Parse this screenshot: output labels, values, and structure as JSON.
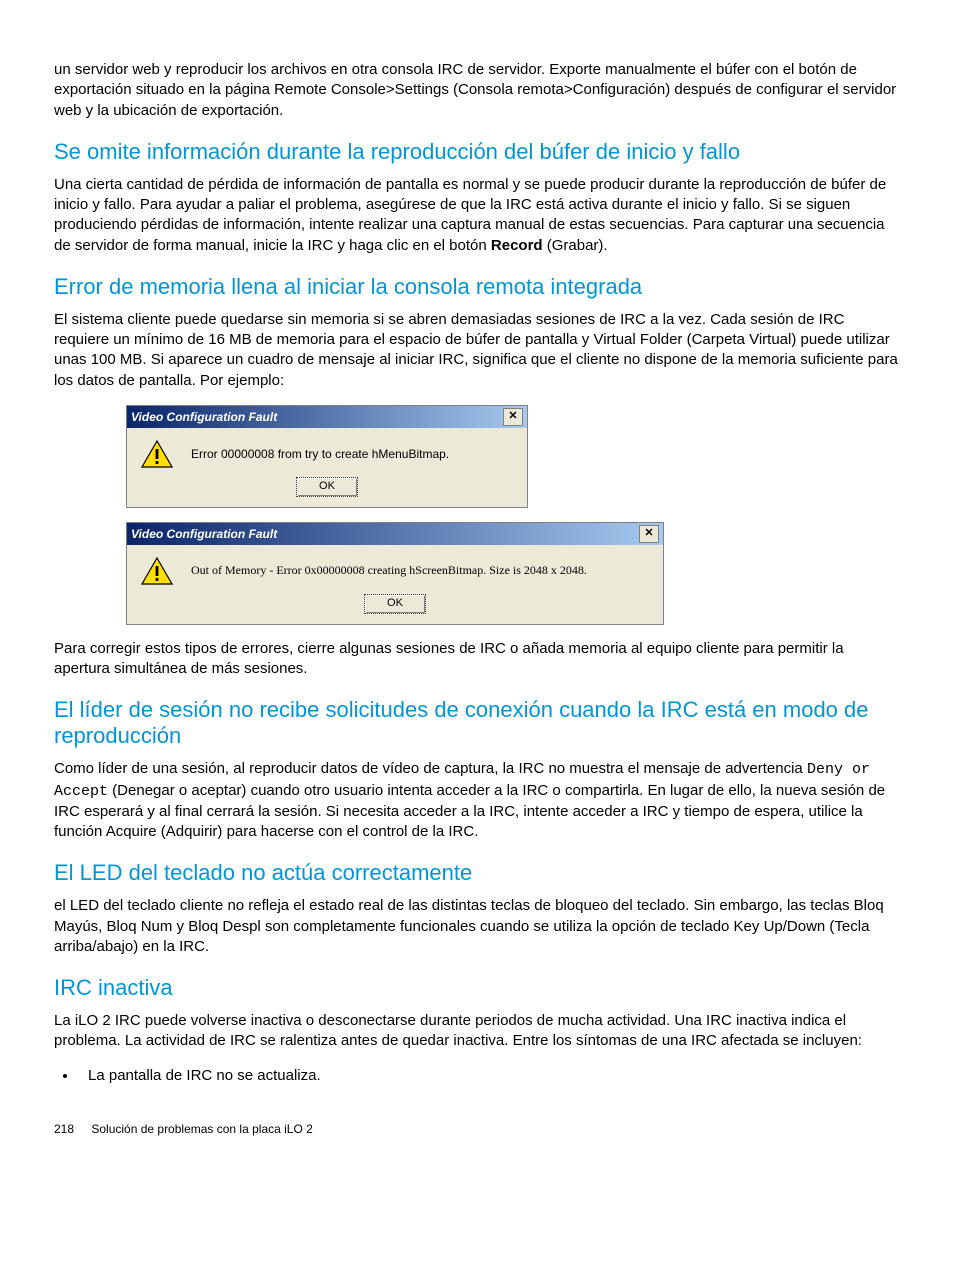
{
  "intro_para": "un servidor web y reproducir los archivos en otra consola IRC de servidor. Exporte manualmente el búfer con el botón de exportación situado en la página Remote Console>Settings (Consola remota>Configuración) después de configurar el servidor web y la ubicación de exportación.",
  "sect1": {
    "title": "Se omite información durante la reproducción del búfer de inicio y fallo",
    "para_pre": "Una cierta cantidad de pérdida de información de pantalla es normal y se puede producir durante la reproducción de búfer de inicio y fallo. Para ayudar a paliar el problema, asegúrese de que la IRC está activa durante el inicio y fallo. Si se siguen produciendo pérdidas de información, intente realizar una captura manual de estas secuencias. Para capturar una secuencia de servidor de forma manual, inicie la IRC y haga clic en el botón ",
    "record_bold": "Record",
    "para_post": " (Grabar)."
  },
  "sect2": {
    "title": "Error de memoria llena al iniciar la consola remota integrada",
    "para1": "El sistema cliente puede quedarse sin memoria si se abren demasiadas sesiones de IRC a la vez. Cada sesión de IRC requiere un mínimo de 16 MB de memoria para el espacio de búfer de pantalla y Virtual Folder (Carpeta Virtual) puede utilizar unas 100 MB. Si aparece un cuadro de mensaje al iniciar IRC, significa que el cliente no dispone de la memoria suficiente para los datos de pantalla. Por ejemplo:",
    "dlg1_title": "Video Configuration Fault",
    "dlg1_msg": "Error 00000008 from try to create hMenuBitmap.",
    "dlg2_title": "Video Configuration Fault",
    "dlg2_msg": "Out of Memory - Error 0x00000008 creating hScreenBitmap. Size is 2048 x 2048.",
    "ok_label": "OK",
    "close_glyph": "✕",
    "para2": "Para corregir estos tipos de errores, cierre algunas sesiones de IRC o añada memoria al equipo cliente para permitir la apertura simultánea de más sesiones."
  },
  "sect3": {
    "title": "El líder de sesión no recibe solicitudes de conexión cuando la IRC está en modo de reproducción",
    "para_pre": "Como líder de una sesión, al reproducir datos de vídeo de captura, la IRC no muestra el mensaje de advertencia ",
    "mono": "Deny or Accept",
    "para_post": " (Denegar o aceptar) cuando otro usuario intenta acceder a la IRC o compartirla. En lugar de ello, la nueva sesión de IRC esperará y al final cerrará la sesión. Si necesita acceder a la IRC, intente acceder a IRC y tiempo de espera, utilice la función Acquire (Adquirir) para hacerse con el control de la IRC."
  },
  "sect4": {
    "title": "El LED del teclado no actúa correctamente",
    "para": "el LED del teclado cliente no refleja el estado real de las distintas teclas de bloqueo del teclado. Sin embargo, las teclas Bloq Mayús, Bloq Num y Bloq Despl son completamente funcionales cuando se utiliza la opción de teclado Key Up/Down (Tecla arriba/abajo) en la IRC."
  },
  "sect5": {
    "title": "IRC inactiva",
    "para": "La iLO 2 IRC puede volverse inactiva o desconectarse durante periodos de mucha actividad. Una IRC inactiva indica el problema. La actividad de IRC se ralentiza antes de quedar inactiva. Entre los síntomas de una IRC afectada se incluyen:",
    "bullet1": "La pantalla de IRC no se actualiza."
  },
  "footer": {
    "page": "218",
    "title": "Solución de problemas con la placa iLO 2"
  }
}
